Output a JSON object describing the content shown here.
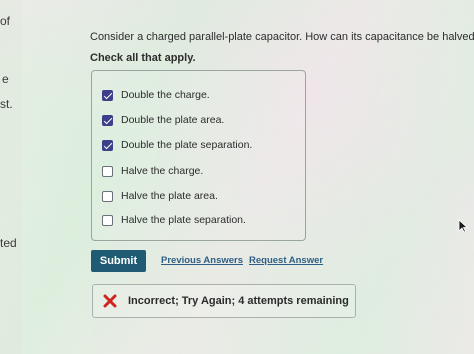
{
  "left_edge": {
    "text_1": "of",
    "text_2": "e",
    "text_3": "st.",
    "text_4": "ted"
  },
  "question": {
    "text": "Consider a charged parallel-plate capacitor. How can its capacitance be halved?",
    "instruction": "Check all that apply."
  },
  "options": [
    {
      "label": "Double the charge.",
      "checked": true
    },
    {
      "label": "Double the plate area.",
      "checked": true
    },
    {
      "label": "Double the plate separation.",
      "checked": true
    },
    {
      "label": "Halve the charge.",
      "checked": false
    },
    {
      "label": "Halve the plate area.",
      "checked": false
    },
    {
      "label": "Halve the plate separation.",
      "checked": false
    }
  ],
  "actions": {
    "submit_label": "Submit",
    "previous_answers_label": "Previous Answers",
    "request_answer_label": "Request Answer"
  },
  "feedback": {
    "icon": "x-icon",
    "text": "Incorrect; Try Again; 4 attempts remaining",
    "icon_color": "#d0251f"
  },
  "colors": {
    "checkbox_checked": "#3d3f8a",
    "submit_button": "#1f5c74",
    "link": "#2f5f86"
  }
}
